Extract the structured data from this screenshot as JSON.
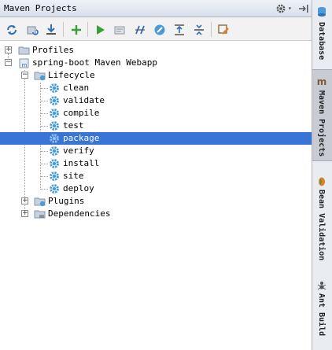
{
  "panel": {
    "title": "Maven Projects",
    "dropdown_caret": "▾"
  },
  "toolbar": {
    "buttons": [
      {
        "name": "reimport-icon",
        "tooltip": ""
      },
      {
        "name": "generate-sources-icon",
        "tooltip": ""
      },
      {
        "name": "download-icon",
        "tooltip": ""
      },
      {
        "name": "add-icon",
        "tooltip": ""
      },
      {
        "name": "run-icon",
        "tooltip": ""
      },
      {
        "name": "run-configuration-icon",
        "tooltip": ""
      },
      {
        "name": "toggle-offline-icon",
        "tooltip": ""
      },
      {
        "name": "skip-tests-icon",
        "tooltip": ""
      },
      {
        "name": "show-dependencies-icon",
        "tooltip": ""
      },
      {
        "name": "collapse-all-icon",
        "tooltip": ""
      },
      {
        "name": "settings-icon",
        "tooltip": ""
      }
    ]
  },
  "tree": {
    "profiles": "Profiles",
    "project": "spring-boot Maven Webapp",
    "lifecycle": "Lifecycle",
    "phases": [
      "clean",
      "validate",
      "compile",
      "test",
      "package",
      "verify",
      "install",
      "site",
      "deploy"
    ],
    "selected_phase": "package",
    "plugins": "Plugins",
    "dependencies": "Dependencies",
    "expander_plus": "+",
    "expander_minus": "−"
  },
  "side_tabs": [
    {
      "label": "Database",
      "active": false
    },
    {
      "label": "Maven Projects",
      "active": true
    },
    {
      "label": "Bean Validation",
      "active": false
    },
    {
      "label": "Ant Build",
      "active": false
    }
  ],
  "colors": {
    "selection": "#3875d7",
    "run_green": "#3a9e3a",
    "gear_blue": "#4a9bd6"
  }
}
